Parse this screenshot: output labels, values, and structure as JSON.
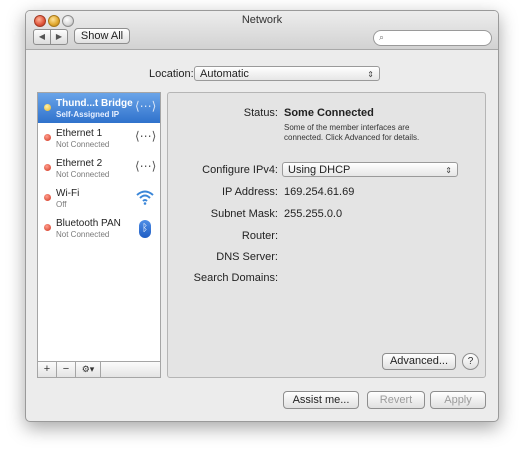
{
  "window": {
    "title": "Network"
  },
  "toolbar": {
    "back_glyph": "◀",
    "forward_glyph": "▶",
    "show_all_label": "Show All",
    "search_placeholder": "",
    "search_glyph": "🔍"
  },
  "location": {
    "label": "Location:",
    "value": "Automatic",
    "arrows": "⌃⌄"
  },
  "sidebar": {
    "items": [
      {
        "name": "Thund...t Bridge",
        "status": "Self-Assigned IP",
        "dot": "yellow",
        "icon": "thunderbolt-bridge-icon",
        "glyph": "<··>",
        "selected": true
      },
      {
        "name": "Ethernet 1",
        "status": "Not Connected",
        "dot": "red",
        "icon": "ethernet-icon",
        "glyph": "<··>",
        "selected": false
      },
      {
        "name": "Ethernet 2",
        "status": "Not Connected",
        "dot": "red",
        "icon": "ethernet-icon",
        "glyph": "<··>",
        "selected": false
      },
      {
        "name": "Wi-Fi",
        "status": "Off",
        "dot": "red",
        "icon": "wifi-icon",
        "glyph": "◠",
        "selected": false
      },
      {
        "name": "Bluetooth PAN",
        "status": "Not Connected",
        "dot": "red",
        "icon": "bluetooth-icon",
        "glyph": "ᛒ",
        "selected": false
      }
    ],
    "add_glyph": "+",
    "remove_glyph": "−",
    "gear_glyph": "⚙▾"
  },
  "detail": {
    "status_label": "Status:",
    "status_value": "Some Connected",
    "status_description": "Some of the member interfaces are connected. Click Advanced for details.",
    "configure_label": "Configure IPv4:",
    "configure_value": "Using DHCP",
    "ip_label": "IP Address:",
    "ip_value": "169.254.61.69",
    "subnet_label": "Subnet Mask:",
    "subnet_value": "255.255.0.0",
    "router_label": "Router:",
    "dns_label": "DNS Server:",
    "search_domains_label": "Search Domains:",
    "advanced_label": "Advanced...",
    "help_glyph": "?"
  },
  "footer": {
    "assist_label": "Assist me...",
    "revert_label": "Revert",
    "apply_label": "Apply"
  },
  "colors": {
    "selection": "#2f72cc",
    "status_red": "#d0301c",
    "status_yellow": "#e6b421"
  }
}
